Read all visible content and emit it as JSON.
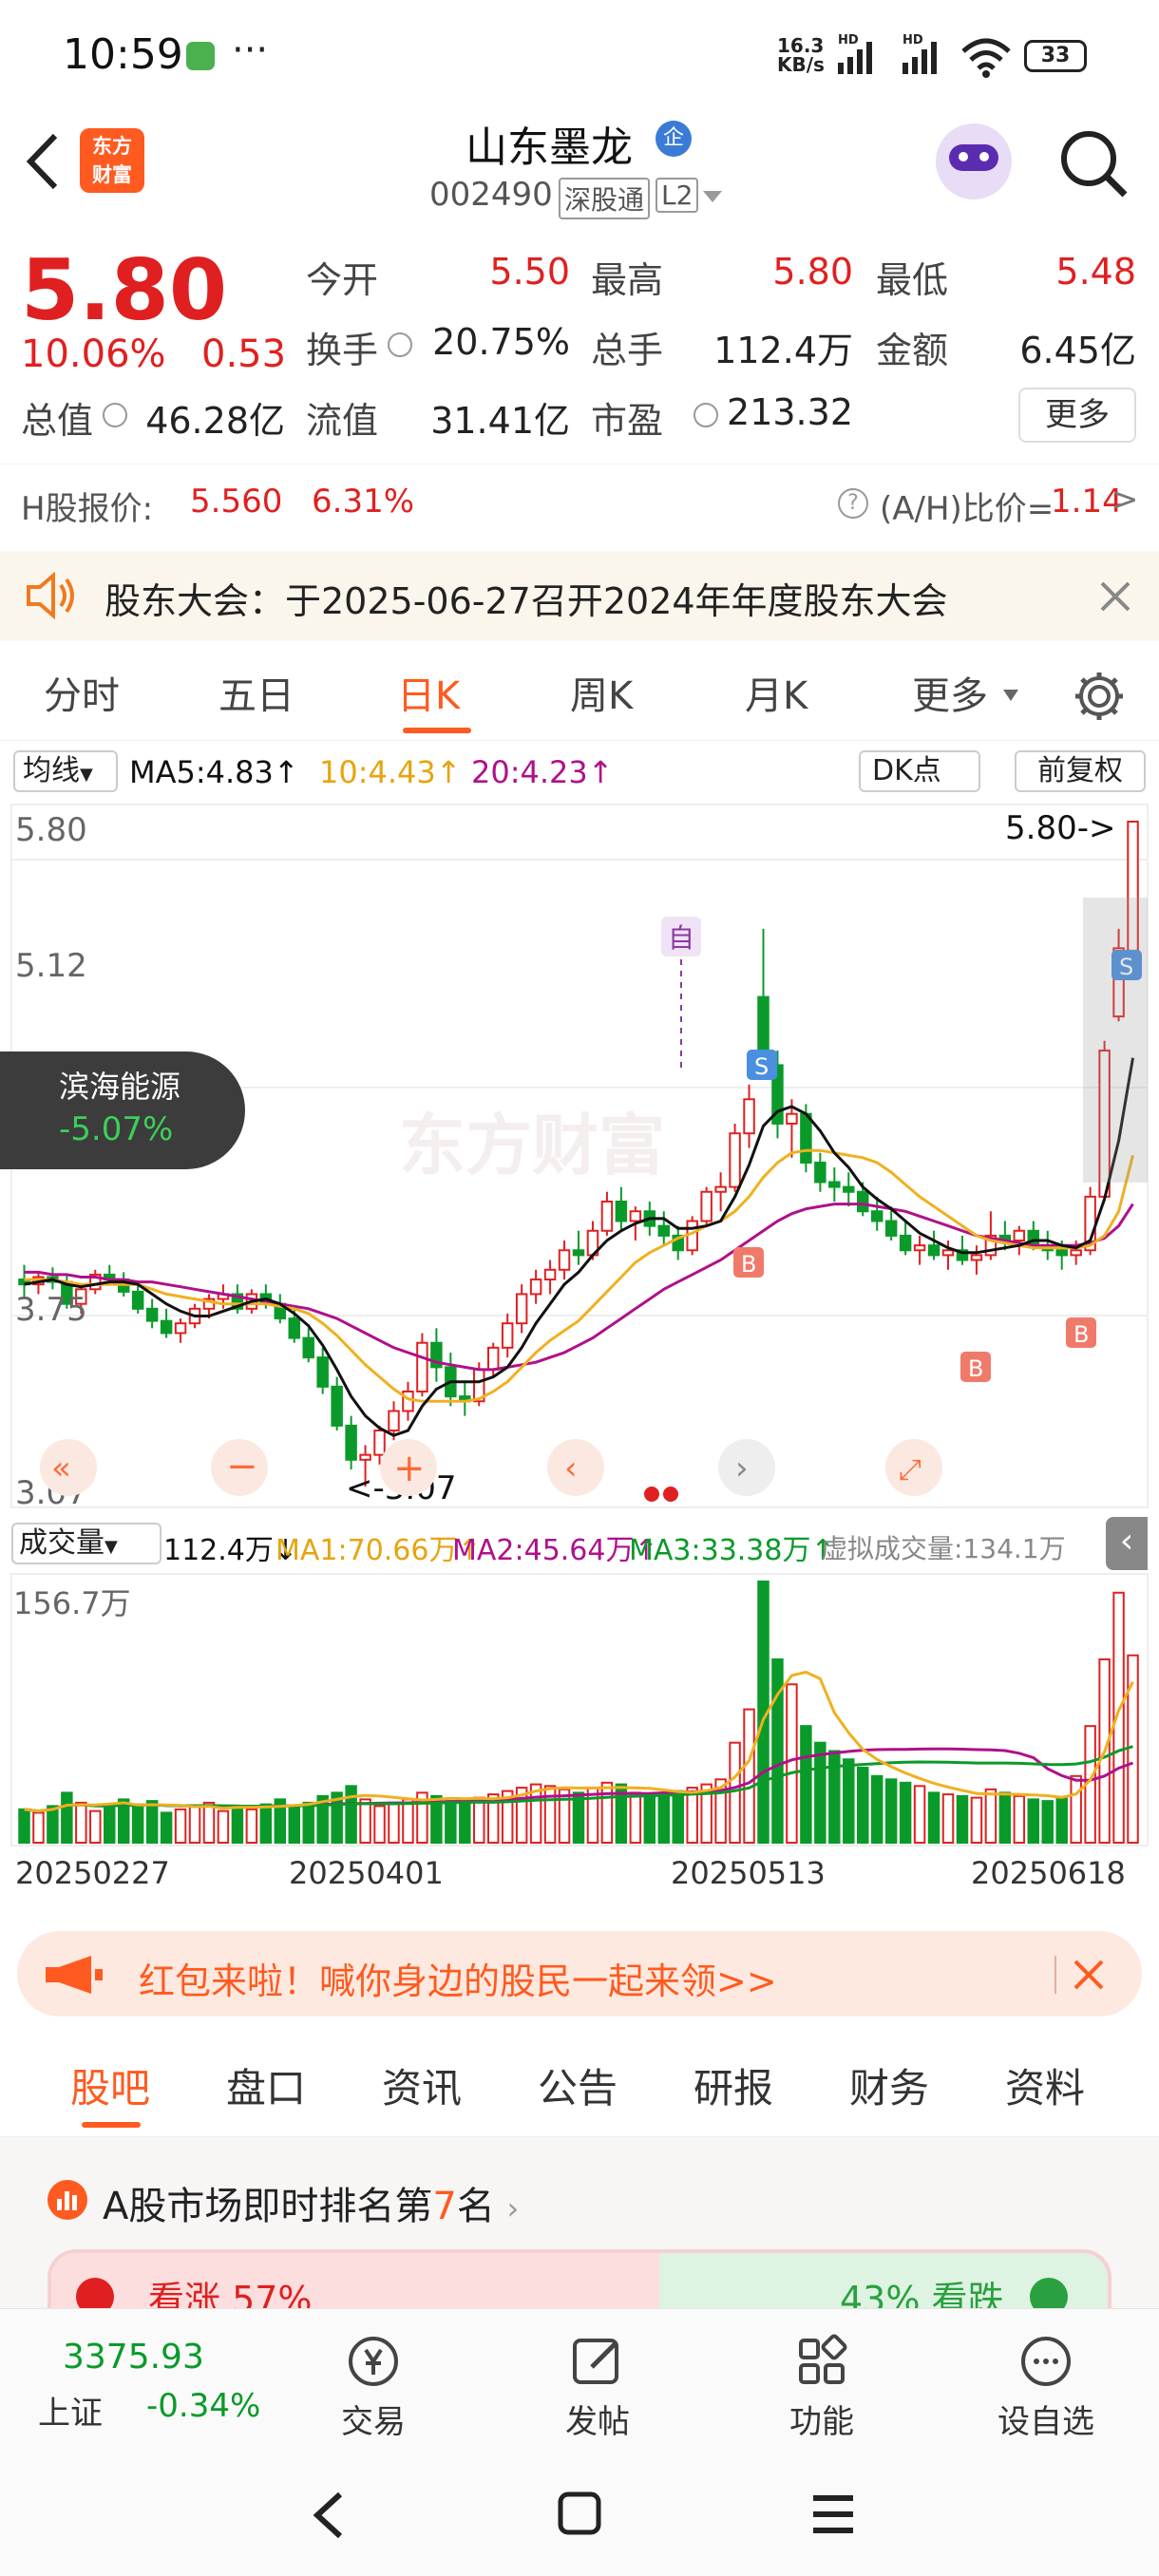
{
  "status_bar": {
    "time": "10:59",
    "net_speed_top": "16.3",
    "net_speed_unit": "KB/s",
    "battery": "33"
  },
  "header": {
    "stock_name": "山东墨龙",
    "badge": "企",
    "code": "002490",
    "market_tag": "深股通",
    "level_tag": "L2"
  },
  "quote": {
    "price": "5.80",
    "change_pct": "10.06%",
    "change_amt": "0.53",
    "open_label": "今开",
    "open": "5.50",
    "high_label": "最高",
    "high": "5.80",
    "low_label": "最低",
    "low": "5.48",
    "turnover_label": "换手",
    "turnover": "20.75%",
    "volume_label": "总手",
    "volume": "112.4万",
    "amount_label": "金额",
    "amount": "6.45亿",
    "mcap_label": "总值",
    "mcap": "46.28亿",
    "float_label": "流值",
    "float_cap": "31.41亿",
    "pe_label": "市盈",
    "pe": "213.32",
    "more_button": "更多"
  },
  "h_share": {
    "label": "H股报价:",
    "price": "5.560",
    "pct": "6.31%",
    "ah_label": "(A/H)比价=",
    "ah_value": "1.14"
  },
  "notice": {
    "text": "股东大会：于2025-06-27召开2024年年度股东大会"
  },
  "chart_tabs": {
    "items": [
      "分时",
      "五日",
      "日K",
      "周K",
      "月K",
      "更多"
    ],
    "active": "日K"
  },
  "ma_legend": {
    "selector": "均线",
    "ma5": "MA5:4.83",
    "ma10": "10:4.43",
    "ma20": "20:4.23",
    "dk": "DK点",
    "adjust": "前复权"
  },
  "chart_labels": {
    "top": "5.80",
    "mid": "5.12",
    "low_partial": "3.75",
    "bottom": "3.07",
    "max_mark": "5.80->",
    "min_mark": "<-3.07",
    "self_tag": "自",
    "watermark": "东方财富"
  },
  "overlay": {
    "name": "滨海能源",
    "pct": "-5.07%"
  },
  "volume_legend": {
    "selector": "成交量",
    "vol": "112.4万",
    "ma1": "MA1:70.66万",
    "ma2": "MA2:45.64万",
    "ma3": "MA3:33.38万",
    "virtual": "虚拟成交量:134.1万",
    "max_label": "156.7万"
  },
  "dates": [
    "20250227",
    "20250401",
    "20250513",
    "20250618"
  ],
  "red_packet": {
    "text": "红包来啦！喊你身边的股民一起来领>>"
  },
  "sub_tabs": {
    "items": [
      "股吧",
      "盘口",
      "资讯",
      "公告",
      "研报",
      "财务",
      "资料"
    ],
    "active": "股吧"
  },
  "rank": {
    "prefix": "A股市场即时排名第",
    "num": "7",
    "suffix": "名",
    "up_text": "看涨 57%",
    "down_text": "43% 看跌"
  },
  "bottom_nav": {
    "index_value": "3375.93",
    "index_name": "上证",
    "index_pct": "-0.34%",
    "trade": "交易",
    "post": "发帖",
    "function": "功能",
    "watch": "设自选"
  },
  "colors": {
    "up": "#e02020",
    "down": "#0a9a2a",
    "ma5": "#111111",
    "ma10": "#f0b020",
    "ma20": "#b0108a",
    "accent": "#ff5a1f"
  },
  "chart_data": {
    "type": "candlestick",
    "y_ticks": [
      "5.80",
      "5.12",
      "3.75",
      "3.07"
    ],
    "ylim": [
      3.07,
      5.8
    ],
    "x_tick_labels": [
      "20250227",
      "20250401",
      "20250513",
      "20250618"
    ],
    "annotations": [
      "5.80->",
      "<-3.07"
    ],
    "candles": [
      [
        3.92,
        3.98,
        3.85,
        3.9
      ],
      [
        3.9,
        3.95,
        3.86,
        3.93
      ],
      [
        3.93,
        3.97,
        3.88,
        3.91
      ],
      [
        3.91,
        3.94,
        3.8,
        3.82
      ],
      [
        3.82,
        3.9,
        3.78,
        3.88
      ],
      [
        3.88,
        3.96,
        3.86,
        3.94
      ],
      [
        3.94,
        3.98,
        3.9,
        3.92
      ],
      [
        3.92,
        3.95,
        3.85,
        3.87
      ],
      [
        3.87,
        3.9,
        3.78,
        3.8
      ],
      [
        3.8,
        3.84,
        3.72,
        3.75
      ],
      [
        3.75,
        3.8,
        3.68,
        3.7
      ],
      [
        3.7,
        3.76,
        3.66,
        3.74
      ],
      [
        3.74,
        3.82,
        3.72,
        3.8
      ],
      [
        3.8,
        3.86,
        3.76,
        3.84
      ],
      [
        3.84,
        3.9,
        3.8,
        3.86
      ],
      [
        3.86,
        3.9,
        3.78,
        3.8
      ],
      [
        3.8,
        3.88,
        3.78,
        3.86
      ],
      [
        3.86,
        3.9,
        3.8,
        3.82
      ],
      [
        3.82,
        3.86,
        3.74,
        3.76
      ],
      [
        3.76,
        3.8,
        3.66,
        3.68
      ],
      [
        3.68,
        3.72,
        3.58,
        3.6
      ],
      [
        3.6,
        3.64,
        3.45,
        3.48
      ],
      [
        3.48,
        3.52,
        3.3,
        3.32
      ],
      [
        3.32,
        3.36,
        3.14,
        3.18
      ],
      [
        3.18,
        3.24,
        3.07,
        3.2
      ],
      [
        3.2,
        3.32,
        3.16,
        3.3
      ],
      [
        3.3,
        3.42,
        3.26,
        3.38
      ],
      [
        3.38,
        3.5,
        3.34,
        3.46
      ],
      [
        3.46,
        3.7,
        3.44,
        3.66
      ],
      [
        3.66,
        3.72,
        3.5,
        3.56
      ],
      [
        3.56,
        3.62,
        3.4,
        3.44
      ],
      [
        3.44,
        3.5,
        3.36,
        3.42
      ],
      [
        3.42,
        3.58,
        3.4,
        3.55
      ],
      [
        3.55,
        3.66,
        3.52,
        3.64
      ],
      [
        3.64,
        3.78,
        3.6,
        3.74
      ],
      [
        3.74,
        3.9,
        3.7,
        3.86
      ],
      [
        3.86,
        3.96,
        3.82,
        3.92
      ],
      [
        3.92,
        4.0,
        3.86,
        3.96
      ],
      [
        3.96,
        4.08,
        3.92,
        4.04
      ],
      [
        4.04,
        4.12,
        3.98,
        4.02
      ],
      [
        4.02,
        4.16,
        4.0,
        4.12
      ],
      [
        4.12,
        4.28,
        4.1,
        4.24
      ],
      [
        4.24,
        4.3,
        4.12,
        4.16
      ],
      [
        4.16,
        4.22,
        4.08,
        4.2
      ],
      [
        4.2,
        4.24,
        4.1,
        4.14
      ],
      [
        4.14,
        4.2,
        4.06,
        4.1
      ],
      [
        4.1,
        4.14,
        4.0,
        4.04
      ],
      [
        4.04,
        4.18,
        4.02,
        4.16
      ],
      [
        4.16,
        4.3,
        4.14,
        4.28
      ],
      [
        4.28,
        4.36,
        4.2,
        4.3
      ],
      [
        4.3,
        4.56,
        4.28,
        4.52
      ],
      [
        4.52,
        4.72,
        4.46,
        4.66
      ],
      [
        5.08,
        5.36,
        4.76,
        4.8
      ],
      [
        4.8,
        4.86,
        4.5,
        4.56
      ],
      [
        4.56,
        4.66,
        4.42,
        4.6
      ],
      [
        4.6,
        4.64,
        4.36,
        4.4
      ],
      [
        4.4,
        4.44,
        4.28,
        4.32
      ],
      [
        4.32,
        4.38,
        4.24,
        4.3
      ],
      [
        4.3,
        4.36,
        4.22,
        4.28
      ],
      [
        4.28,
        4.32,
        4.18,
        4.2
      ],
      [
        4.2,
        4.26,
        4.12,
        4.16
      ],
      [
        4.16,
        4.22,
        4.08,
        4.1
      ],
      [
        4.1,
        4.16,
        4.02,
        4.04
      ],
      [
        4.04,
        4.1,
        3.98,
        4.06
      ],
      [
        4.06,
        4.12,
        4.0,
        4.02
      ],
      [
        4.02,
        4.08,
        3.96,
        4.04
      ],
      [
        4.04,
        4.1,
        3.98,
        4.0
      ],
      [
        4.0,
        4.06,
        3.94,
        4.02
      ],
      [
        4.02,
        4.2,
        4.0,
        4.1
      ],
      [
        4.1,
        4.16,
        4.04,
        4.08
      ],
      [
        4.08,
        4.14,
        4.02,
        4.12
      ],
      [
        4.12,
        4.16,
        4.04,
        4.06
      ],
      [
        4.06,
        4.12,
        4.0,
        4.04
      ],
      [
        4.04,
        4.08,
        3.96,
        4.02
      ],
      [
        4.02,
        4.08,
        3.98,
        4.04
      ],
      [
        4.04,
        4.3,
        4.02,
        4.26
      ],
      [
        4.26,
        4.9,
        4.24,
        4.86
      ],
      [
        5.0,
        5.36,
        4.98,
        5.28
      ],
      [
        5.27,
        5.8,
        5.2,
        5.8
      ]
    ],
    "volume_max": 156.7,
    "volumes": [
      20,
      18,
      22,
      30,
      24,
      19,
      21,
      26,
      23,
      25,
      18,
      20,
      22,
      24,
      19,
      21,
      20,
      23,
      26,
      22,
      24,
      28,
      30,
      34,
      26,
      22,
      24,
      26,
      30,
      28,
      25,
      23,
      27,
      29,
      31,
      33,
      35,
      34,
      32,
      30,
      33,
      36,
      35,
      30,
      29,
      28,
      31,
      33,
      35,
      38,
      60,
      80,
      156.7,
      110,
      95,
      70,
      60,
      55,
      50,
      45,
      40,
      38,
      36,
      34,
      30,
      29,
      28,
      27,
      32,
      30,
      28,
      26,
      25,
      27,
      40,
      70,
      110,
      150,
      112.4
    ],
    "ma5": [
      3.9,
      3.91,
      3.92,
      3.9,
      3.89,
      3.9,
      3.91,
      3.91,
      3.9,
      3.86,
      3.82,
      3.79,
      3.77,
      3.77,
      3.79,
      3.81,
      3.83,
      3.84,
      3.82,
      3.78,
      3.73,
      3.65,
      3.55,
      3.44,
      3.36,
      3.31,
      3.28,
      3.3,
      3.4,
      3.47,
      3.5,
      3.5,
      3.5,
      3.52,
      3.56,
      3.64,
      3.74,
      3.82,
      3.9,
      3.95,
      4.02,
      4.08,
      4.12,
      4.15,
      4.17,
      4.17,
      4.13,
      4.13,
      4.14,
      4.16,
      4.26,
      4.39,
      4.55,
      4.61,
      4.63,
      4.6,
      4.53,
      4.44,
      4.38,
      4.3,
      4.25,
      4.21,
      4.16,
      4.11,
      4.08,
      4.05,
      4.03,
      4.03,
      4.04,
      4.05,
      4.06,
      4.08,
      4.08,
      4.06,
      4.05,
      4.08,
      4.25,
      4.49,
      4.83
    ],
    "ma10": [
      3.92,
      3.92,
      3.92,
      3.91,
      3.9,
      3.9,
      3.9,
      3.9,
      3.9,
      3.88,
      3.86,
      3.85,
      3.84,
      3.83,
      3.82,
      3.82,
      3.82,
      3.82,
      3.81,
      3.8,
      3.78,
      3.74,
      3.69,
      3.63,
      3.57,
      3.52,
      3.47,
      3.43,
      3.42,
      3.42,
      3.42,
      3.42,
      3.43,
      3.46,
      3.5,
      3.56,
      3.62,
      3.67,
      3.71,
      3.75,
      3.81,
      3.87,
      3.93,
      3.99,
      4.03,
      4.06,
      4.09,
      4.11,
      4.14,
      4.16,
      4.2,
      4.26,
      4.34,
      4.4,
      4.44,
      4.45,
      4.45,
      4.44,
      4.43,
      4.42,
      4.4,
      4.36,
      4.31,
      4.26,
      4.22,
      4.18,
      4.14,
      4.1,
      4.08,
      4.07,
      4.06,
      4.05,
      4.05,
      4.05,
      4.05,
      4.06,
      4.1,
      4.2,
      4.43
    ],
    "ma20": [
      3.95,
      3.95,
      3.94,
      3.94,
      3.93,
      3.93,
      3.92,
      3.92,
      3.91,
      3.91,
      3.9,
      3.89,
      3.88,
      3.87,
      3.86,
      3.85,
      3.84,
      3.83,
      3.82,
      3.81,
      3.8,
      3.78,
      3.76,
      3.73,
      3.7,
      3.67,
      3.64,
      3.62,
      3.6,
      3.58,
      3.57,
      3.56,
      3.55,
      3.55,
      3.56,
      3.57,
      3.58,
      3.6,
      3.62,
      3.65,
      3.68,
      3.72,
      3.76,
      3.8,
      3.84,
      3.88,
      3.91,
      3.94,
      3.97,
      4.0,
      4.04,
      4.08,
      4.12,
      4.16,
      4.19,
      4.21,
      4.22,
      4.23,
      4.23,
      4.23,
      4.22,
      4.21,
      4.2,
      4.18,
      4.16,
      4.14,
      4.12,
      4.1,
      4.09,
      4.08,
      4.07,
      4.06,
      4.06,
      4.06,
      4.06,
      4.07,
      4.09,
      4.14,
      4.23
    ]
  }
}
